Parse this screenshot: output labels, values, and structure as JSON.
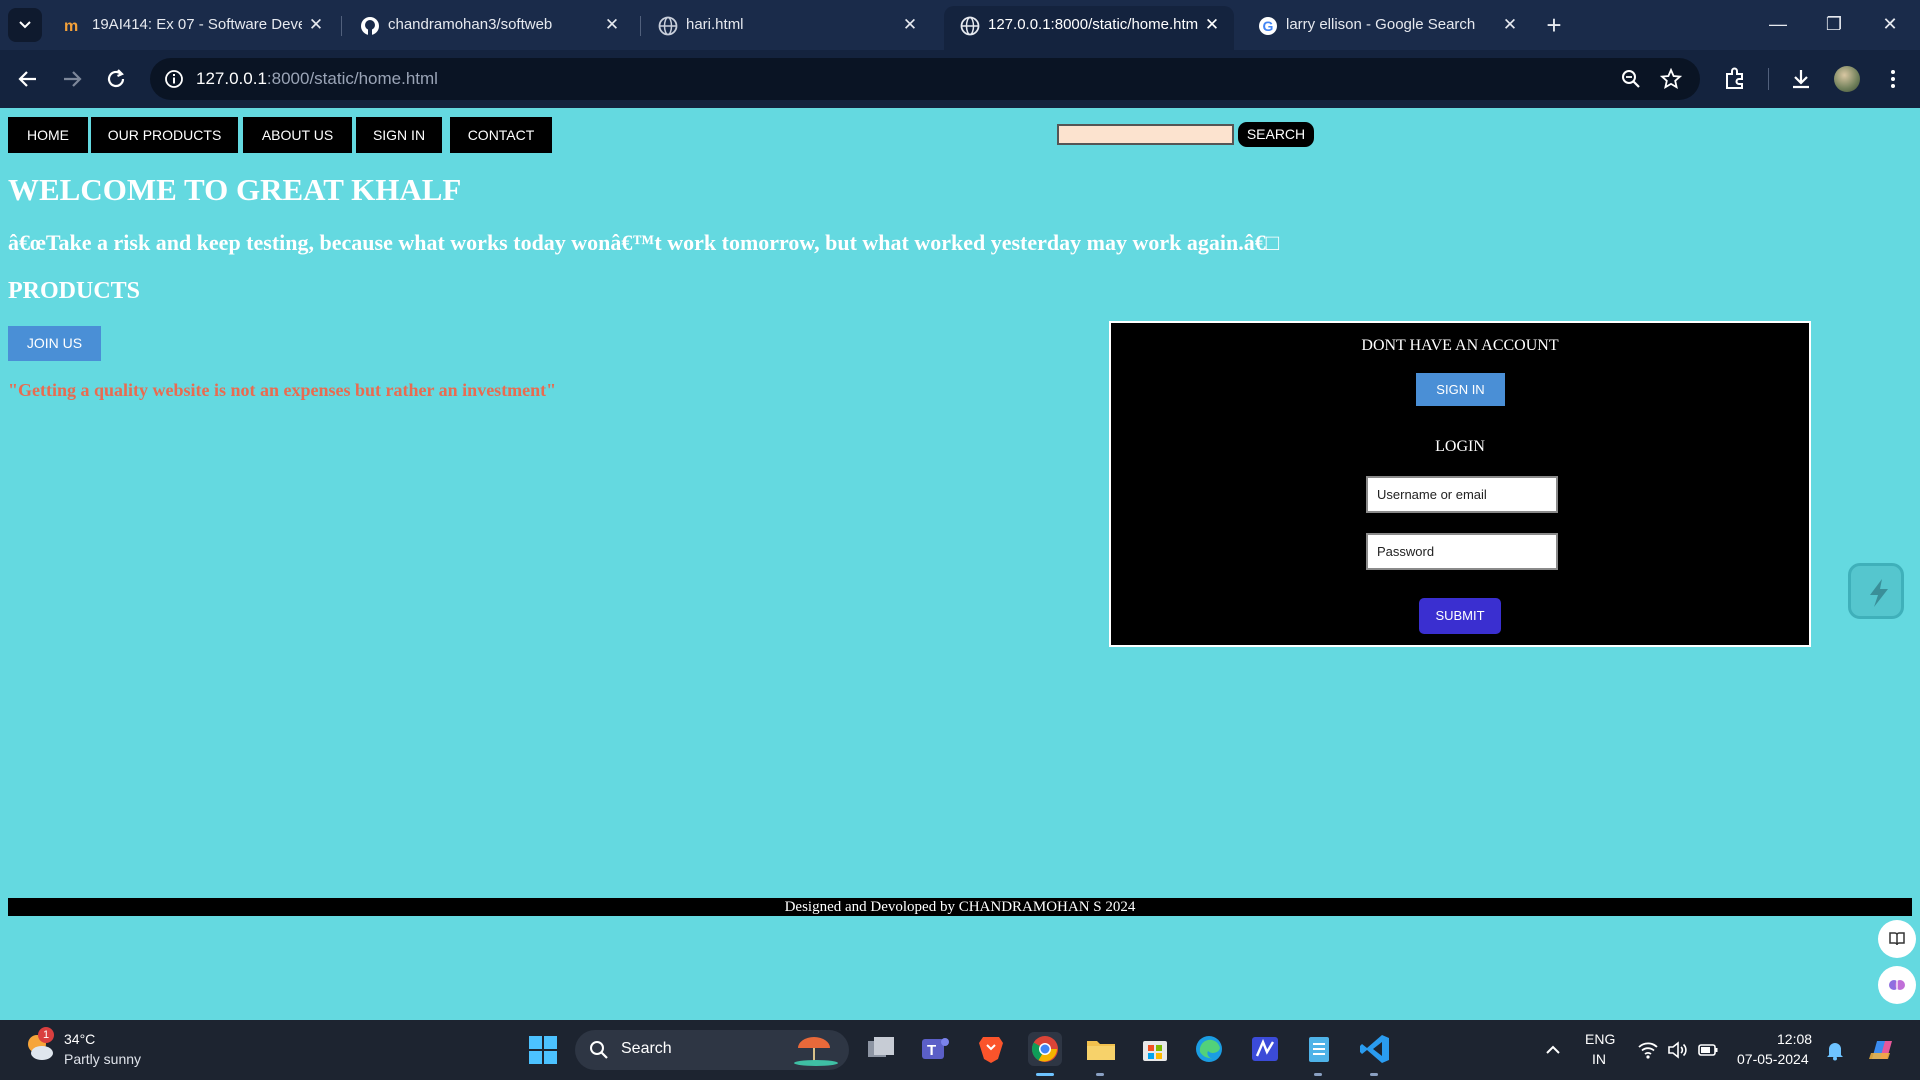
{
  "browser": {
    "tabs": [
      {
        "title": "19AI414: Ex 07 - Software Devel",
        "icon": "moodle-icon"
      },
      {
        "title": "chandramohan3/softweb",
        "icon": "github-icon"
      },
      {
        "title": "hari.html",
        "icon": "globe-icon"
      },
      {
        "title": "127.0.0.1:8000/static/home.htm",
        "icon": "globe-icon",
        "active": true
      },
      {
        "title": "larry ellison - Google Search",
        "icon": "google-icon"
      }
    ],
    "url_host": "127.0.0.1",
    "url_path": ":8000/static/home.html"
  },
  "page": {
    "nav": [
      "HOME",
      "OUR PRODUCTS",
      "ABOUT US",
      "SIGN IN",
      "CONTACT"
    ],
    "search_button": "SEARCH",
    "welcome": "WELCOME TO GREAT KHALF",
    "quote": "â€œTake a risk and keep testing, because what works today wonâ€™t work tomorrow, but what worked yesterday may work again.â€□",
    "products_heading": "PRODUCTS",
    "join_button": "JOIN US",
    "tagline": "\"Getting a quality website is not an expenses but rather an investment\"",
    "account_box": {
      "no_account_heading": "DONT HAVE AN ACCOUNT",
      "sign_in_button": "SIGN IN",
      "login_heading": "LOGIN",
      "username_placeholder": "Username or email",
      "password_placeholder": "Password",
      "submit_button": "SUBMIT"
    },
    "footer": "Designed and Devoloped by CHANDRAMOHAN S 2024"
  },
  "taskbar": {
    "weather_temp": "34°C",
    "weather_desc": "Partly sunny",
    "weather_badge": "1",
    "search_label": "Search",
    "lang_top": "ENG",
    "lang_bottom": "IN",
    "time": "12:08",
    "date": "07-05-2024"
  },
  "colors": {
    "page_bg": "#64d9e0",
    "nav_bg": "#000000",
    "button_blue": "#4a8fd6",
    "submit_purple": "#3a2fd0",
    "tagline_orange": "#e96b50",
    "search_field_bg": "#fce3cf"
  }
}
